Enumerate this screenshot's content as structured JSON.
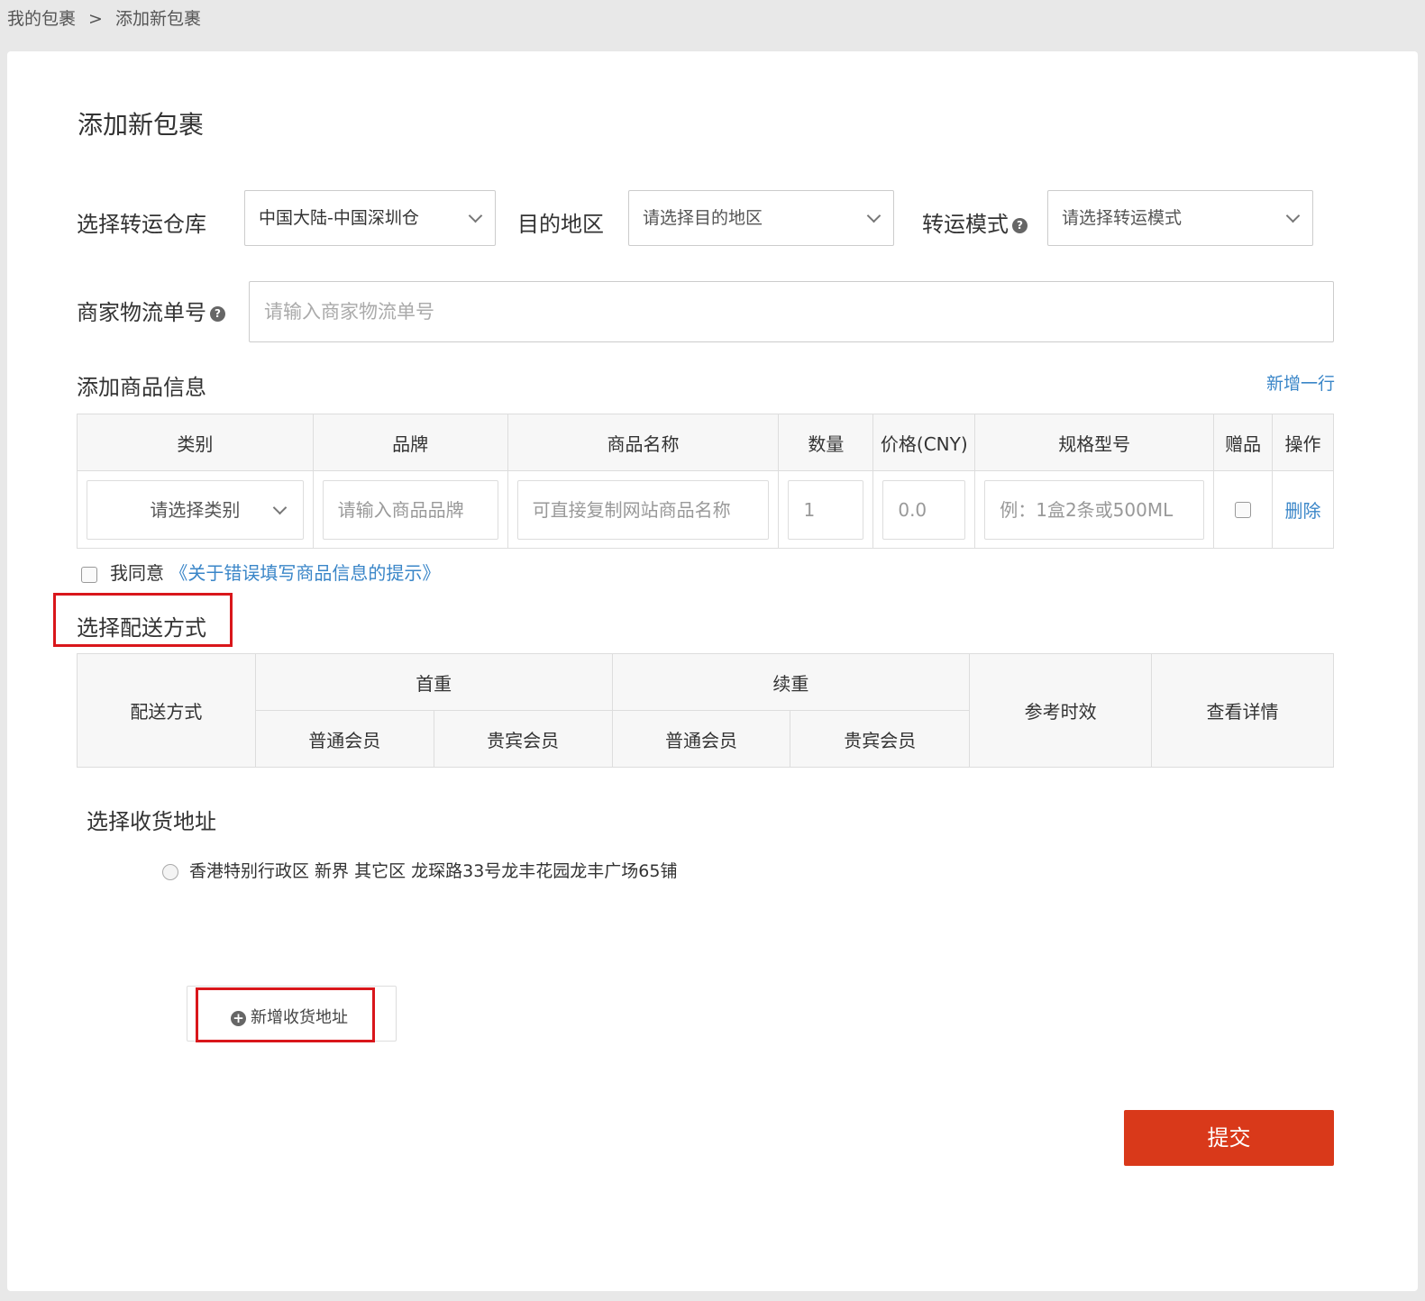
{
  "breadcrumb": {
    "home": "我的包裹",
    "separator": ">",
    "current": "添加新包裹"
  },
  "page": {
    "title": "添加新包裹"
  },
  "warehouse": {
    "label": "选择转运仓库",
    "value": "中国大陆-中国深圳仓"
  },
  "destination": {
    "label": "目的地区",
    "placeholder": "请选择目的地区"
  },
  "mode": {
    "label": "转运模式",
    "placeholder": "请选择转运模式"
  },
  "tracking": {
    "label": "商家物流单号",
    "placeholder": "请输入商家物流单号"
  },
  "goods": {
    "heading": "添加商品信息",
    "add_row": "新增一行",
    "columns": [
      "类别",
      "品牌",
      "商品名称",
      "数量",
      "价格(CNY)",
      "规格型号",
      "赠品",
      "操作"
    ],
    "row": {
      "category": "请选择类别",
      "brand_placeholder": "请输入商品品牌",
      "name_placeholder": "可直接复制网站商品名称",
      "quantity": "1",
      "price": "0.0",
      "spec_placeholder": "例：1盒2条或500ML",
      "delete": "删除"
    }
  },
  "agree": {
    "text": "我同意",
    "link": "《关于错误填写商品信息的提示》"
  },
  "shipping": {
    "heading": "选择配送方式",
    "col_method": "配送方式",
    "col_first": "首重",
    "col_extra": "续重",
    "col_time": "参考时效",
    "col_detail": "查看详情",
    "regular": "普通会员",
    "vip": "贵宾会员"
  },
  "address": {
    "heading": "选择收货地址",
    "item": "香港特别行政区 新界 其它区 龙琛路33号龙丰花园龙丰广场65铺",
    "add_button": "新增收货地址"
  },
  "submit": "提交",
  "colors": {
    "accent": "#3a86c8",
    "submit": "#d9391a",
    "highlight": "#d9161b"
  }
}
